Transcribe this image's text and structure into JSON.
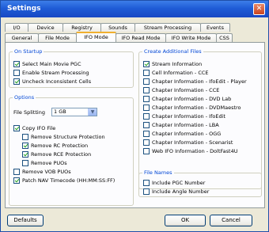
{
  "window": {
    "title": "Settings",
    "close_glyph": "✕"
  },
  "tabs_top": [
    "I/O",
    "Device",
    "Registry",
    "Sounds",
    "Stream Processing",
    "Events"
  ],
  "tabs_bottom": [
    "General",
    "File Mode",
    "IFO Mode",
    "IFO Read Mode",
    "IFO Write Mode",
    "CSS"
  ],
  "active_tab": "IFO Mode",
  "on_startup": {
    "title": "On Startup",
    "items": [
      {
        "label": "Select Main Movie PGC",
        "checked": true
      },
      {
        "label": "Enable Stream Processing",
        "checked": false
      },
      {
        "label": "Uncheck Inconsistent Cells",
        "checked": true
      }
    ]
  },
  "options": {
    "title": "Options",
    "file_splitting_label": "File Splitting",
    "file_splitting_value": "1 GB",
    "items": [
      {
        "label": "Copy IFO File",
        "checked": true
      },
      {
        "label": "Remove Structure Protection",
        "checked": false
      },
      {
        "label": "Remove RC Protection",
        "checked": true
      },
      {
        "label": "Remove RCE Protection",
        "checked": true
      },
      {
        "label": "Remove PUOs",
        "checked": false
      },
      {
        "label": "Remove VOB PUOs",
        "checked": false
      },
      {
        "label": "Patch NAV Timecode (HH:MM:SS:FF)",
        "checked": true
      }
    ]
  },
  "create_files": {
    "title": "Create Additional Files",
    "items": [
      {
        "label": "Stream Information",
        "checked": true
      },
      {
        "label": "Cell Information - CCE",
        "checked": false
      },
      {
        "label": "Chapter Information - IfoEdit - Player",
        "checked": false
      },
      {
        "label": "Chapter Information - CCE",
        "checked": false
      },
      {
        "label": "Chapter Information - DVD Lab",
        "checked": false
      },
      {
        "label": "Chapter Information - DVDMaestro",
        "checked": false
      },
      {
        "label": "Chapter Information - IfoEdit",
        "checked": false
      },
      {
        "label": "Chapter Information - LBA",
        "checked": false
      },
      {
        "label": "Chapter Information - OGG",
        "checked": false
      },
      {
        "label": "Chapter Information - Scenarist",
        "checked": false
      },
      {
        "label": "Web IFO Information - DoltFast4U",
        "checked": false
      }
    ]
  },
  "file_names": {
    "title": "File Names",
    "items": [
      {
        "label": "Include PGC Number",
        "checked": false
      },
      {
        "label": "Include Angle Number",
        "checked": false
      }
    ]
  },
  "buttons": {
    "defaults": "Defaults",
    "ok": "OK",
    "cancel": "Cancel"
  }
}
